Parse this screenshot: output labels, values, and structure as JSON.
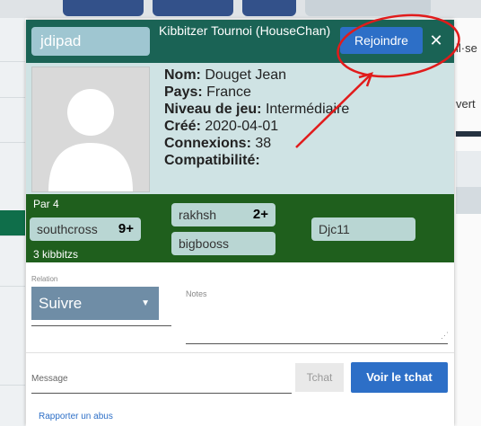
{
  "background": {
    "side_text_1": "il·se",
    "side_text_2": "vert"
  },
  "header": {
    "username": "jdipad",
    "tournament_title": "Kibbitzer Tournoi (HouseChan)",
    "join_label": "Rejoindre",
    "close_icon": "close-icon"
  },
  "profile": {
    "avatar_icon": "avatar-placeholder-icon",
    "nom_label": "Nom:",
    "nom_value": "Douget Jean",
    "pays_label": "Pays:",
    "pays_value": "France",
    "niveau_label": "Niveau de jeu:",
    "niveau_value": "Intermédiaire",
    "cree_label": "Créé:",
    "cree_value": "2020-04-01",
    "connexions_label": "Connexions:",
    "connexions_value": "38",
    "compat_label": "Compatibilité:"
  },
  "stats": {
    "par": "Par 4",
    "kibbitzs": "3 kibbitzs",
    "players": [
      {
        "name": "southcross",
        "badge": "9+"
      },
      {
        "name": "rakhsh",
        "badge": "2+"
      },
      {
        "name": "Djc11",
        "badge": ""
      },
      {
        "name": "bigbooss",
        "badge": ""
      }
    ]
  },
  "form": {
    "relation_label": "Relation",
    "relation_value": "Suivre",
    "notes_label": "Notes",
    "message_label": "Message",
    "tchat_label": "Tchat",
    "voir_tchat_label": "Voir le tchat",
    "report_label": "Rapporter un abus"
  },
  "colors": {
    "header_bg": "#1a6355",
    "stats_bg": "#1f5f1d",
    "accent_blue": "#2d6fc7",
    "annotation_red": "#e11b1b"
  }
}
